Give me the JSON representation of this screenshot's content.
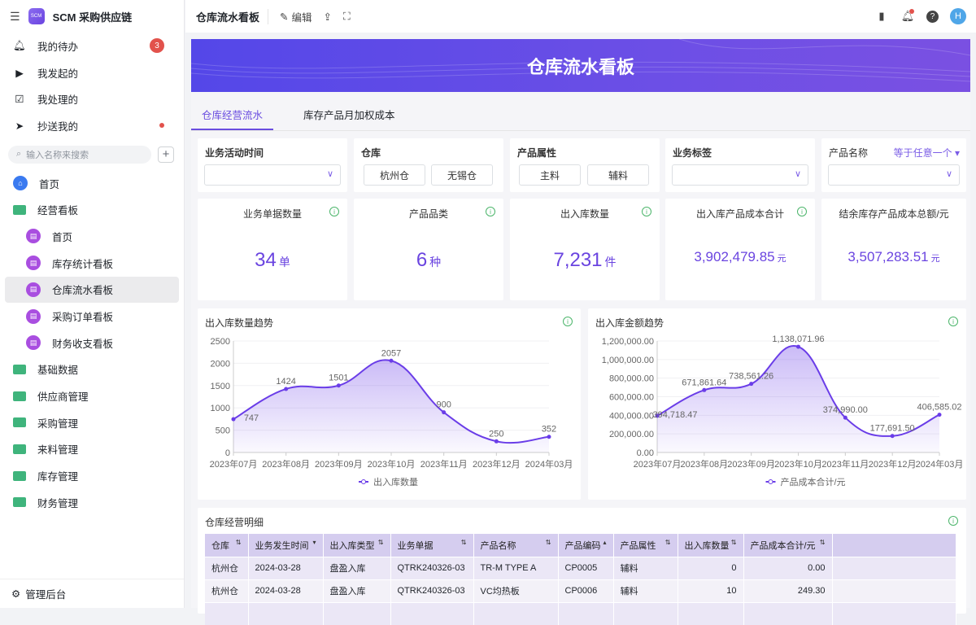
{
  "app": {
    "title": "SCM 采购供应链",
    "logo_text": "SCM"
  },
  "sidebar": {
    "quick": [
      {
        "label": "我的待办",
        "badge": "3"
      },
      {
        "label": "我发起的"
      },
      {
        "label": "我处理的"
      },
      {
        "label": "抄送我的"
      }
    ],
    "search_placeholder": "输入名称来搜索",
    "items": [
      {
        "label": "首页"
      },
      {
        "label": "经营看板"
      }
    ],
    "sub_items": [
      {
        "label": "首页"
      },
      {
        "label": "库存统计看板"
      },
      {
        "label": "仓库流水看板"
      },
      {
        "label": "采购订单看板"
      },
      {
        "label": "财务收支看板"
      }
    ],
    "folders": [
      {
        "label": "基础数据"
      },
      {
        "label": "供应商管理"
      },
      {
        "label": "采购管理"
      },
      {
        "label": "来料管理"
      },
      {
        "label": "库存管理"
      },
      {
        "label": "财务管理"
      }
    ],
    "footer": "管理后台"
  },
  "topbar": {
    "title": "仓库流水看板",
    "edit": "编辑",
    "avatar": "H"
  },
  "banner": {
    "title": "仓库流水看板"
  },
  "tabs": [
    {
      "label": "仓库经营流水"
    },
    {
      "label": "库存产品月加权成本"
    }
  ],
  "filters": {
    "time": "业务活动时间",
    "warehouse": "仓库",
    "warehouse_options": [
      "杭州仓",
      "无锡仓"
    ],
    "attr": "产品属性",
    "attr_options": [
      "主料",
      "辅料"
    ],
    "tag": "业务标签",
    "product": "产品名称",
    "product_mode": "等于任意一个"
  },
  "kpis": [
    {
      "title": "业务单据数量",
      "value": "34",
      "unit": "单"
    },
    {
      "title": "产品品类",
      "value": "6",
      "unit": "种"
    },
    {
      "title": "出入库数量",
      "value": "7,231",
      "unit": "件"
    },
    {
      "title": "出入库产品成本合计",
      "value": "3,902,479.85",
      "unit": "元"
    },
    {
      "title": "结余库存产品成本总额/元",
      "value": "3,507,283.51",
      "unit": "元"
    }
  ],
  "chart_data": [
    {
      "type": "area",
      "title": "出入库数量趋势",
      "categories": [
        "2023年07月",
        "2023年08月",
        "2023年09月",
        "2023年10月",
        "2023年11月",
        "2023年12月",
        "2024年03月"
      ],
      "series": [
        {
          "name": "出入库数量",
          "values": [
            747,
            1424,
            1501,
            2057,
            900,
            250,
            352
          ]
        }
      ],
      "labels": [
        "747",
        "1424",
        "1501",
        "2057",
        "900",
        "250",
        "352"
      ],
      "ylim": [
        0,
        2500
      ],
      "yticks": [
        "0",
        "500",
        "1000",
        "1500",
        "2000",
        "2500"
      ],
      "color": "#6a3de8"
    },
    {
      "type": "area",
      "title": "出入库金额趋势",
      "categories": [
        "2023年07月",
        "2023年08月",
        "2023年09月",
        "2023年10月",
        "2023年11月",
        "2023年12月",
        "2024年03月"
      ],
      "series": [
        {
          "name": "产品成本合计/元",
          "values": [
            394718.47,
            671861.64,
            738561.26,
            1138071.96,
            374990.0,
            177691.5,
            406585.02
          ]
        }
      ],
      "labels": [
        "394,718.47",
        "671,861.64",
        "738,561.26",
        "1,138,071.96",
        "374,990.00",
        "177,691.50",
        "406,585.02"
      ],
      "ylim": [
        0,
        1200000
      ],
      "yticks": [
        "0.00",
        "200,000.00",
        "400,000.00",
        "600,000.00",
        "800,000.00",
        "1,000,000.00",
        "1,200,000.00"
      ],
      "color": "#6a3de8"
    }
  ],
  "table": {
    "title": "仓库经营明细",
    "columns": [
      "仓库",
      "业务发生时间",
      "出入库类型",
      "业务单据",
      "产品名称",
      "产品编码",
      "产品属性",
      "出入库数量",
      "产品成本合计/元"
    ],
    "sort": [
      "⇅",
      "▾",
      "⇅",
      "⇅",
      "⇅",
      "▴",
      "⇅",
      "⇅",
      "⇅"
    ],
    "rows": [
      [
        "杭州仓",
        "2024-03-28",
        "盘盈入库",
        "QTRK240326-03",
        "TR-M TYPE A",
        "CP0005",
        "辅料",
        "0",
        "0.00"
      ],
      [
        "杭州仓",
        "2024-03-28",
        "盘盈入库",
        "QTRK240326-03",
        "VC均热板",
        "CP0006",
        "辅料",
        "10",
        "249.30"
      ]
    ]
  }
}
